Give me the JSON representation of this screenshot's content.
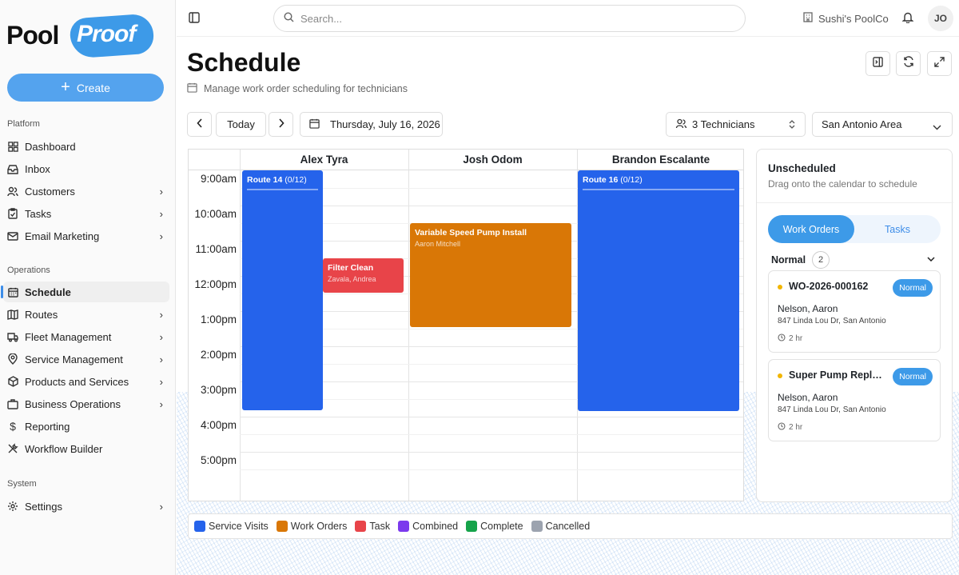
{
  "brand": {
    "word1": "Pool",
    "word2": "Proof"
  },
  "sidebar": {
    "create_label": "Create",
    "sections": {
      "platform": "Platform",
      "operations": "Operations",
      "system": "System"
    },
    "items": [
      {
        "label": "Dashboard",
        "icon": "grid-icon"
      },
      {
        "label": "Inbox",
        "icon": "inbox-icon"
      },
      {
        "label": "Customers",
        "icon": "users-icon"
      },
      {
        "label": "Tasks",
        "icon": "clipboard-icon"
      },
      {
        "label": "Email Marketing",
        "icon": "mail-icon"
      },
      {
        "label": "Schedule",
        "icon": "calendar-icon"
      },
      {
        "label": "Routes",
        "icon": "map-icon"
      },
      {
        "label": "Fleet Management",
        "icon": "truck-icon"
      },
      {
        "label": "Service Management",
        "icon": "pin-icon"
      },
      {
        "label": "Products and Services",
        "icon": "box-icon"
      },
      {
        "label": "Business Operations",
        "icon": "briefcase-icon"
      },
      {
        "label": "Reporting",
        "icon": "dollar-icon"
      },
      {
        "label": "Workflow Builder",
        "icon": "tools-icon"
      },
      {
        "label": "Settings",
        "icon": "gear-icon"
      }
    ]
  },
  "topbar": {
    "search_placeholder": "Search...",
    "company": "Sushi's PoolCo",
    "avatar": "JO"
  },
  "page": {
    "title": "Schedule",
    "subtitle": "Manage work order scheduling for technicians"
  },
  "controls": {
    "today": "Today",
    "date": "Thursday, July 16, 2026",
    "technicians": "3 Technicians",
    "area": "San Antonio Area"
  },
  "calendar": {
    "technicians": [
      "Alex Tyra",
      "Josh Odom",
      "Brandon Escalante"
    ],
    "times": [
      "9:00am",
      "10:00am",
      "11:00am",
      "12:00pm",
      "1:00pm",
      "2:00pm",
      "3:00pm",
      "4:00pm",
      "5:00pm"
    ],
    "events": [
      {
        "title": "Route 14",
        "count": "(0/12)",
        "subtitle": "",
        "color": "#2563eb"
      },
      {
        "title": "Filter Clean",
        "count": "",
        "subtitle": "Zavala, Andrea",
        "color": "#e84449"
      },
      {
        "title": "Variable Speed Pump Install",
        "count": "",
        "subtitle": "Aaron Mitchell",
        "color": "#d97706"
      },
      {
        "title": "Route 16",
        "count": "(0/12)",
        "subtitle": "",
        "color": "#2563eb"
      }
    ]
  },
  "unscheduled": {
    "title": "Unscheduled",
    "subtitle": "Drag onto the calendar to schedule",
    "tabs": [
      "Work Orders",
      "Tasks"
    ],
    "group": "Normal",
    "group_count": "2",
    "cards": [
      {
        "id": "WO-2026-000162",
        "badge": "Normal",
        "name": "Nelson, Aaron",
        "address": "847 Linda Lou Dr, San Antonio",
        "duration": "2 hr"
      },
      {
        "id": "Super Pump Replacement",
        "badge": "Normal",
        "name": "Nelson, Aaron",
        "address": "847 Linda Lou Dr, San Antonio",
        "duration": "2 hr"
      }
    ]
  },
  "legend": [
    {
      "label": "Service Visits",
      "color": "#2563eb"
    },
    {
      "label": "Work Orders",
      "color": "#d97706"
    },
    {
      "label": "Task",
      "color": "#e84449"
    },
    {
      "label": "Combined",
      "color": "#7c3aed"
    },
    {
      "label": "Complete",
      "color": "#16a34a"
    },
    {
      "label": "Cancelled",
      "color": "#9ca3af"
    }
  ]
}
